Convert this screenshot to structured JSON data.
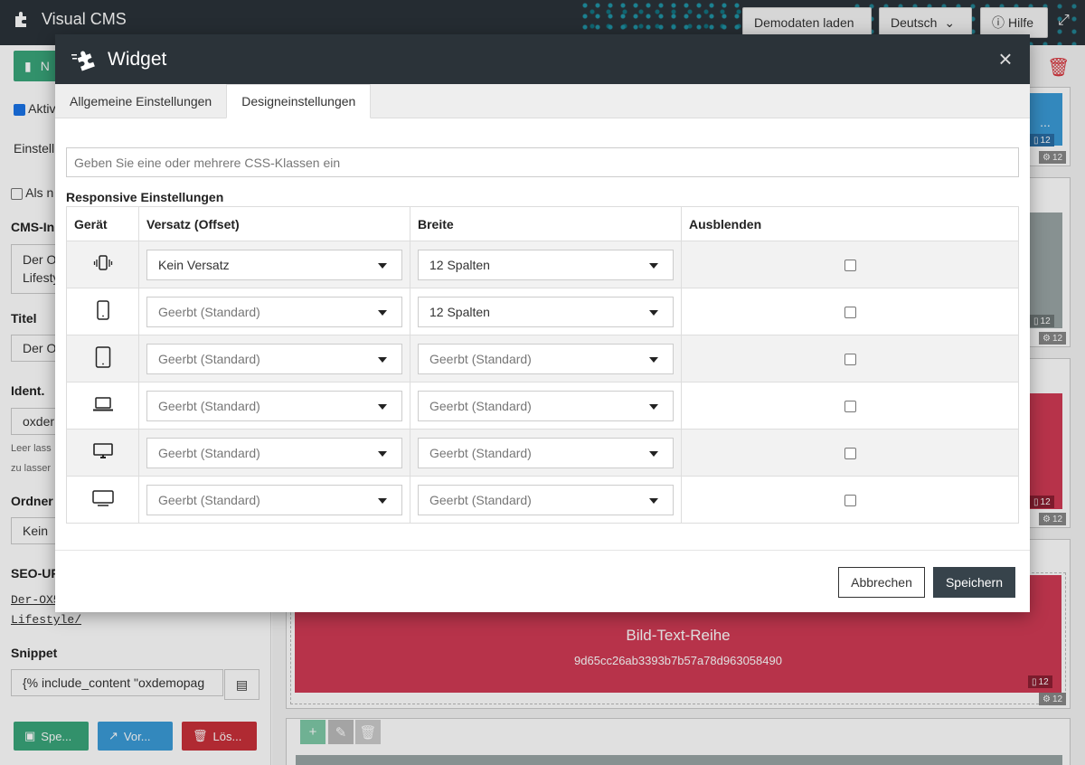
{
  "app": {
    "title": "Visual CMS",
    "demo_button": "Demodaten laden",
    "language": "Deutsch",
    "help": "Hilfe"
  },
  "left_panel": {
    "new_label": "N",
    "active_label": "Aktiv",
    "settings_label": "Einstell",
    "als_label": "Als n",
    "cms_label": "CMS-In",
    "cms_value_1": "Der O",
    "cms_value_2": "Lifesty",
    "title_label": "Titel",
    "title_value": "Der O",
    "ident_label": "Ident.",
    "ident_value": "oxder",
    "ident_hint_1": "Leer lass",
    "ident_hint_2": "zu lasser",
    "folder_label": "Ordner",
    "folder_value": "Kein",
    "seo_label": "SEO-UR",
    "seo_value_1": "Der-OX5",
    "seo_value_2": "Lifestyle/",
    "snippet_label": "Snippet",
    "snippet_value": "{% include_content \"oxdemopag",
    "save": "Spe...",
    "preview": "Vor...",
    "delete": "Lös..."
  },
  "right_area": {
    "partial_text": "...",
    "row_title": "Bild-Text-Reihe",
    "row_id": "9d65cc26ab3393b7b57a78d963058490",
    "col_badge": "12"
  },
  "modal": {
    "title": "Widget",
    "tabs": [
      {
        "label": "Allgemeine Einstellungen"
      },
      {
        "label": "Designeinstellungen"
      }
    ],
    "css_placeholder": "Geben Sie eine oder mehrere CSS-Klassen ein",
    "responsive_label": "Responsive Einstellungen",
    "columns": {
      "device": "Gerät",
      "offset": "Versatz (Offset)",
      "width": "Breite",
      "hide": "Ausblenden"
    },
    "rows": [
      {
        "device_icon": "vibrating-phone-icon",
        "offset": "Kein Versatz",
        "width": "12 Spalten"
      },
      {
        "device_icon": "phone-icon",
        "offset": "Geerbt (Standard)",
        "width": "12 Spalten"
      },
      {
        "device_icon": "tablet-icon",
        "offset": "Geerbt (Standard)",
        "width": "Geerbt (Standard)"
      },
      {
        "device_icon": "laptop-icon",
        "offset": "Geerbt (Standard)",
        "width": "Geerbt (Standard)"
      },
      {
        "device_icon": "desktop-icon",
        "offset": "Geerbt (Standard)",
        "width": "Geerbt (Standard)"
      },
      {
        "device_icon": "tv-icon",
        "offset": "Geerbt (Standard)",
        "width": "Geerbt (Standard)"
      }
    ],
    "cancel": "Abbrechen",
    "save": "Speichern"
  },
  "colors": {
    "header_bg": "#2b3339",
    "save_green": "#3aa57a",
    "preview_blue": "#3b9bd8",
    "delete_red": "#c9303a",
    "row_red": "#d13b55",
    "primary_dark": "#37434b"
  }
}
